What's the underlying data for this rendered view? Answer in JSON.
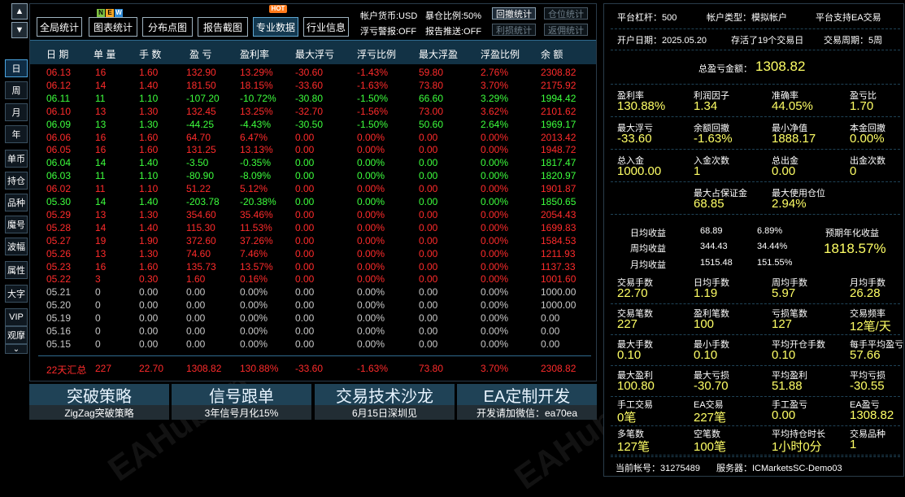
{
  "nav": {
    "up_arrow": "▲",
    "down_arrow": "▼",
    "items": [
      "日",
      "周",
      "月",
      "年",
      "单币",
      "持仓",
      "品种",
      "魔号",
      "波幅",
      "属性",
      "大字",
      "VIP",
      "观摩"
    ],
    "more": "⌄"
  },
  "toolbar": {
    "buttons": [
      "全局统计",
      "图表统计",
      "分布点图",
      "报告截图",
      "专业数据",
      "行业信息"
    ],
    "new_badge": [
      "N",
      "E",
      "W"
    ],
    "hot_badge": "HOT",
    "account_currency": "帐户货币:USD",
    "exposure_ratio": "暴仓比例:50%",
    "float_alert": "浮亏警报:OFF",
    "report_push": "报告推送:OFF",
    "btn_drawdown_stats": "回撤统计",
    "btn_position_stats": "仓位统计",
    "btn_profit_stats": "利损统计",
    "btn_rebate_stats": "返佣统计"
  },
  "table": {
    "headers": [
      "日 期",
      "单 量",
      "手 数",
      "盈 亏",
      "盈利率",
      "最大浮亏",
      "浮亏比例",
      "最大浮盈",
      "浮盈比例",
      "余 额"
    ],
    "rows": [
      {
        "c": "red",
        "v": [
          "06.13",
          "16",
          "1.60",
          "132.90",
          "13.29%",
          "-30.60",
          "-1.43%",
          "59.80",
          "2.76%",
          "2308.82"
        ]
      },
      {
        "c": "red",
        "v": [
          "06.12",
          "14",
          "1.40",
          "181.50",
          "18.15%",
          "-33.60",
          "-1.63%",
          "73.80",
          "3.70%",
          "2175.92"
        ]
      },
      {
        "c": "green",
        "v": [
          "06.11",
          "11",
          "1.10",
          "-107.20",
          "-10.72%",
          "-30.80",
          "-1.50%",
          "66.60",
          "3.29%",
          "1994.42"
        ]
      },
      {
        "c": "red",
        "v": [
          "06.10",
          "13",
          "1.30",
          "132.45",
          "13.25%",
          "-32.70",
          "-1.56%",
          "73.00",
          "3.62%",
          "2101.62"
        ]
      },
      {
        "c": "green",
        "v": [
          "06.09",
          "13",
          "1.30",
          "-44.25",
          "-4.43%",
          "-30.50",
          "-1.50%",
          "50.60",
          "2.64%",
          "1969.17"
        ]
      },
      {
        "c": "red",
        "v": [
          "06.06",
          "16",
          "1.60",
          "64.70",
          "6.47%",
          "0.00",
          "0.00%",
          "0.00",
          "0.00%",
          "2013.42"
        ]
      },
      {
        "c": "red",
        "v": [
          "06.05",
          "16",
          "1.60",
          "131.25",
          "13.13%",
          "0.00",
          "0.00%",
          "0.00",
          "0.00%",
          "1948.72"
        ]
      },
      {
        "c": "green",
        "v": [
          "06.04",
          "14",
          "1.40",
          "-3.50",
          "-0.35%",
          "0.00",
          "0.00%",
          "0.00",
          "0.00%",
          "1817.47"
        ]
      },
      {
        "c": "green",
        "v": [
          "06.03",
          "11",
          "1.10",
          "-80.90",
          "-8.09%",
          "0.00",
          "0.00%",
          "0.00",
          "0.00%",
          "1820.97"
        ]
      },
      {
        "c": "red",
        "v": [
          "06.02",
          "11",
          "1.10",
          "51.22",
          "5.12%",
          "0.00",
          "0.00%",
          "0.00",
          "0.00%",
          "1901.87"
        ]
      },
      {
        "c": "green",
        "v": [
          "05.30",
          "14",
          "1.40",
          "-203.78",
          "-20.38%",
          "0.00",
          "0.00%",
          "0.00",
          "0.00%",
          "1850.65"
        ]
      },
      {
        "c": "red",
        "v": [
          "05.29",
          "13",
          "1.30",
          "354.60",
          "35.46%",
          "0.00",
          "0.00%",
          "0.00",
          "0.00%",
          "2054.43"
        ]
      },
      {
        "c": "red",
        "v": [
          "05.28",
          "14",
          "1.40",
          "115.30",
          "11.53%",
          "0.00",
          "0.00%",
          "0.00",
          "0.00%",
          "1699.83"
        ]
      },
      {
        "c": "red",
        "v": [
          "05.27",
          "19",
          "1.90",
          "372.60",
          "37.26%",
          "0.00",
          "0.00%",
          "0.00",
          "0.00%",
          "1584.53"
        ]
      },
      {
        "c": "red",
        "v": [
          "05.26",
          "13",
          "1.30",
          "74.60",
          "7.46%",
          "0.00",
          "0.00%",
          "0.00",
          "0.00%",
          "1211.93"
        ]
      },
      {
        "c": "red",
        "v": [
          "05.23",
          "16",
          "1.60",
          "135.73",
          "13.57%",
          "0.00",
          "0.00%",
          "0.00",
          "0.00%",
          "1137.33"
        ]
      },
      {
        "c": "red",
        "v": [
          "05.22",
          "3",
          "0.30",
          "1.60",
          "0.16%",
          "0.00",
          "0.00%",
          "0.00",
          "0.00%",
          "1001.60"
        ]
      },
      {
        "c": "gray",
        "v": [
          "05.21",
          "0",
          "0.00",
          "0.00",
          "0.00%",
          "0.00",
          "0.00%",
          "0.00",
          "0.00%",
          "1000.00"
        ]
      },
      {
        "c": "gray",
        "v": [
          "05.20",
          "0",
          "0.00",
          "0.00",
          "0.00%",
          "0.00",
          "0.00%",
          "0.00",
          "0.00%",
          "1000.00"
        ]
      },
      {
        "c": "gray",
        "v": [
          "05.19",
          "0",
          "0.00",
          "0.00",
          "0.00%",
          "0.00",
          "0.00%",
          "0.00",
          "0.00%",
          "0.00"
        ]
      },
      {
        "c": "gray",
        "v": [
          "05.16",
          "0",
          "0.00",
          "0.00",
          "0.00%",
          "0.00",
          "0.00%",
          "0.00",
          "0.00%",
          "0.00"
        ]
      },
      {
        "c": "gray",
        "v": [
          "05.15",
          "0",
          "0.00",
          "0.00",
          "0.00%",
          "0.00",
          "0.00%",
          "0.00",
          "0.00%",
          "0.00"
        ]
      }
    ],
    "summary": [
      "22天汇总",
      "227",
      "22.70",
      "1308.82",
      "130.88%",
      "-33.60",
      "-1.63%",
      "73.80",
      "3.70%",
      "2308.82"
    ]
  },
  "banners": [
    {
      "title": "突破策略",
      "sub": "ZigZag突破策略"
    },
    {
      "title": "信号跟单",
      "sub": "3年信号月化15%"
    },
    {
      "title": "交易技术沙龙",
      "sub": "6月15日深圳见"
    },
    {
      "title": "EA定制开发",
      "sub": "开发请加微信：ea70ea"
    }
  ],
  "right": {
    "leverage": "平台杠杆：500",
    "account_type": "帐户类型：模拟帐户",
    "ea_support": "平台支持EA交易",
    "open_date": "开户日期：2025.05.20",
    "survived": "存活了19个交易日",
    "trade_cycle": "交易周期：5周",
    "total_pl_label": "总盈亏金额：",
    "total_pl_value": "1308.82",
    "g1": [
      {
        "label": "盈利率",
        "value": "130.88%"
      },
      {
        "label": "利润因子",
        "value": "1.34"
      },
      {
        "label": "准确率",
        "value": "44.05%"
      },
      {
        "label": "盈亏比",
        "value": "1.70"
      }
    ],
    "g2": [
      {
        "label": "最大浮亏",
        "value": "-33.60"
      },
      {
        "label": "余额回撤",
        "value": "-1.63%"
      },
      {
        "label": "最小净值",
        "value": "1888.17"
      },
      {
        "label": "本金回撤",
        "value": "0.00%"
      }
    ],
    "g3": [
      {
        "label": "总入金",
        "value": "1000.00"
      },
      {
        "label": "入金次数",
        "value": "1"
      },
      {
        "label": "总出金",
        "value": "0.00"
      },
      {
        "label": "出金次数",
        "value": "0"
      }
    ],
    "g4": [
      {
        "label": "最大占保证金",
        "value": "68.85"
      },
      {
        "label": "最大使用仓位",
        "value": "2.94%"
      }
    ],
    "avg": [
      {
        "label": "日均收益",
        "amount": "68.89",
        "pct": "6.89%"
      },
      {
        "label": "周均收益",
        "amount": "344.43",
        "pct": "34.44%"
      },
      {
        "label": "月均收益",
        "amount": "1515.48",
        "pct": "151.55%"
      }
    ],
    "annual_label": "预期年化收益",
    "annual_value": "1818.57%",
    "g5": [
      {
        "label": "交易手数",
        "value": "22.70"
      },
      {
        "label": "日均手数",
        "value": "1.19"
      },
      {
        "label": "周均手数",
        "value": "5.97"
      },
      {
        "label": "月均手数",
        "value": "26.28"
      }
    ],
    "g6": [
      {
        "label": "交易笔数",
        "value": "227"
      },
      {
        "label": "盈利笔数",
        "value": "100"
      },
      {
        "label": "亏损笔数",
        "value": "127"
      },
      {
        "label": "交易频率",
        "value": "12笔/天"
      }
    ],
    "g7": [
      {
        "label": "最大手数",
        "value": "0.10"
      },
      {
        "label": "最小手数",
        "value": "0.10"
      },
      {
        "label": "平均开仓手数",
        "value": "0.10"
      },
      {
        "label": "每手平均盈亏",
        "value": "57.66"
      }
    ],
    "g8": [
      {
        "label": "最大盈利",
        "value": "100.80"
      },
      {
        "label": "最大亏损",
        "value": "-30.70"
      },
      {
        "label": "平均盈利",
        "value": "51.88"
      },
      {
        "label": "平均亏损",
        "value": "-30.55"
      }
    ],
    "g9": [
      {
        "label": "手工交易",
        "value": "0笔"
      },
      {
        "label": "EA交易",
        "value": "227笔"
      },
      {
        "label": "手工盈亏",
        "value": "0.00"
      },
      {
        "label": "EA盈亏",
        "value": "1308.82"
      }
    ],
    "g10": [
      {
        "label": "多笔数",
        "value": "127笔"
      },
      {
        "label": "空笔数",
        "value": "100笔"
      },
      {
        "label": "平均持仓时长",
        "value": "1小时0分"
      },
      {
        "label": "交易品种",
        "value": "1"
      }
    ],
    "account_no": "当前帐号：31275489",
    "server": "服务器：ICMarketsSC-Demo03"
  },
  "watermark": "EAHub.cn",
  "colors": {
    "profit": "#ff2b2b",
    "loss": "#3dff3d",
    "neutral": "#c8c8c8",
    "value": "#ffff66",
    "accent": "#123245"
  }
}
